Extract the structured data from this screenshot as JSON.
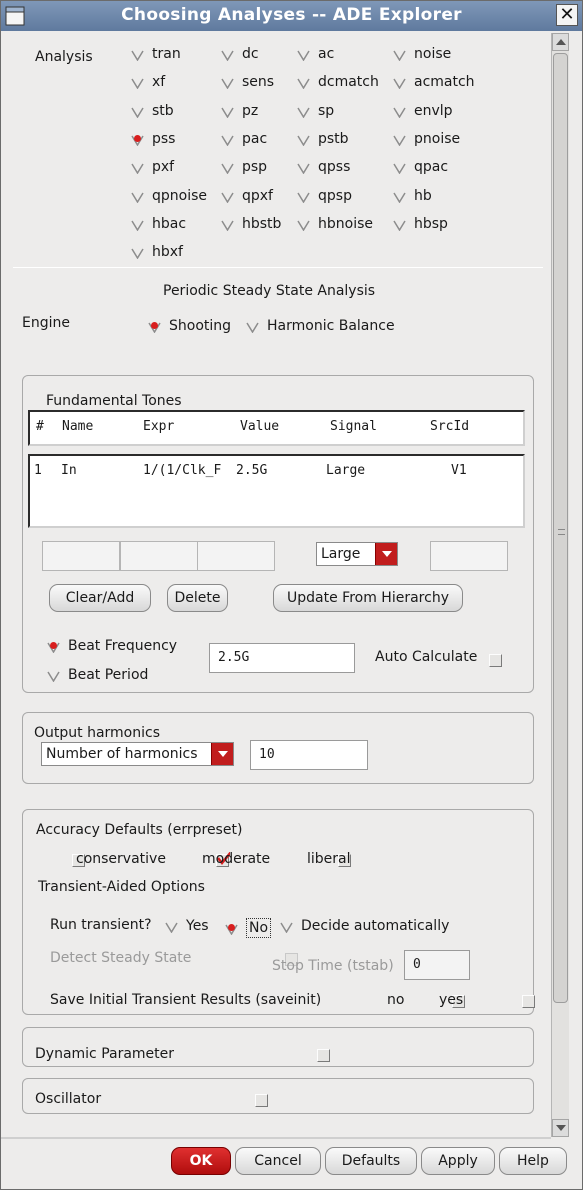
{
  "window": {
    "title": "Choosing Analyses -- ADE Explorer"
  },
  "analysis": {
    "label": "Analysis",
    "options": [
      "tran",
      "dc",
      "ac",
      "noise",
      "xf",
      "sens",
      "dcmatch",
      "acmatch",
      "stb",
      "pz",
      "sp",
      "envlp",
      "pss",
      "pac",
      "pstb",
      "pnoise",
      "pxf",
      "psp",
      "qpss",
      "qpac",
      "qpnoise",
      "qpxf",
      "qpsp",
      "hb",
      "hbac",
      "hbstb",
      "hbnoise",
      "hbsp",
      "hbxf"
    ],
    "selected": "pss"
  },
  "pss": {
    "heading": "Periodic Steady State Analysis",
    "engine_label": "Engine",
    "engine_shooting": "Shooting",
    "engine_hb": "Harmonic Balance",
    "engine_selected": "Shooting"
  },
  "fundamental": {
    "title": "Fundamental Tones",
    "columns": [
      "#",
      "Name",
      "Expr",
      "Value",
      "Signal",
      "SrcId"
    ],
    "rows": [
      [
        "1",
        "In",
        "1/(1/Clk_F",
        "2.5G",
        "Large",
        "V1"
      ]
    ],
    "signal_select": "Large",
    "buttons": {
      "clear_add": "Clear/Add",
      "delete": "Delete",
      "update": "Update From Hierarchy"
    },
    "beat_frequency": "Beat Frequency",
    "beat_period": "Beat Period",
    "beat_selected": "Beat Frequency",
    "beat_value": "2.5G",
    "auto_calculate": "Auto Calculate"
  },
  "output": {
    "title": "Output harmonics",
    "select": "Number of harmonics",
    "value": "10"
  },
  "accuracy": {
    "title": "Accuracy Defaults (errpreset)",
    "conservative": "conservative",
    "moderate": "moderate",
    "liberal": "liberal",
    "checked": "moderate",
    "transient_title": "Transient-Aided Options",
    "run_transient": "Run transient?",
    "yes": "Yes",
    "no": "No",
    "decide": "Decide automatically",
    "run_selected": "No",
    "detect_steady": "Detect Steady State",
    "stop_time": "Stop Time (tstab)",
    "stop_value": "0",
    "save_initial": "Save Initial Transient Results (saveinit)",
    "save_no": "no",
    "save_yes": "yes"
  },
  "dynamic_parameter": "Dynamic Parameter",
  "oscillator": "Oscillator",
  "footer": {
    "ok": "OK",
    "cancel": "Cancel",
    "defaults": "Defaults",
    "apply": "Apply",
    "help": "Help"
  },
  "colors": {
    "accent_red": "#c11d1d",
    "title_bar": "#6d86a8"
  }
}
